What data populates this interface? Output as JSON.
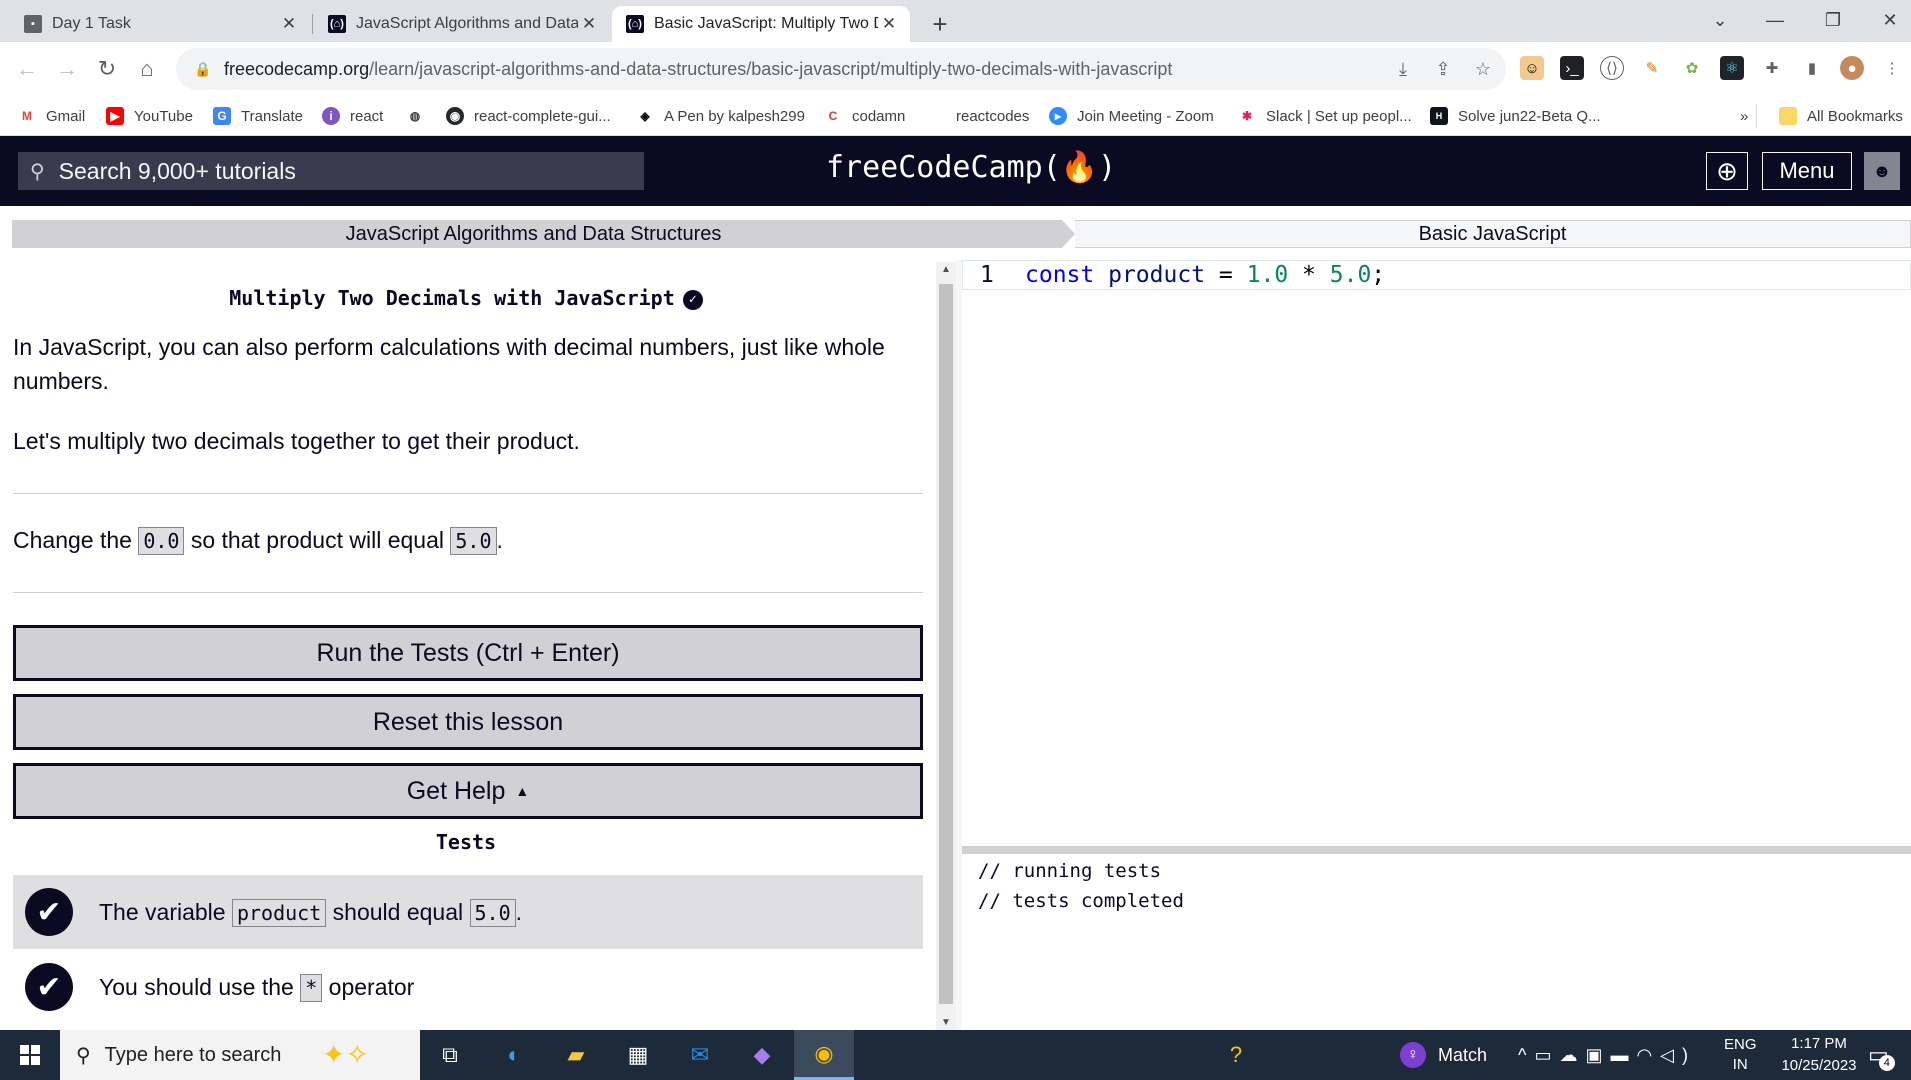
{
  "browser": {
    "tabs": [
      {
        "title": "Day 1 Task",
        "active": false
      },
      {
        "title": "JavaScript Algorithms and Data Structures",
        "active": false
      },
      {
        "title": "Basic JavaScript: Multiply Two Decimals with JavaScript",
        "active": true
      }
    ],
    "url_host": "freecodecamp.org",
    "url_path": "/learn/javascript-algorithms-and-data-structures/basic-javascript/multiply-two-decimals-with-javascript",
    "bookmarks": [
      {
        "label": "Gmail",
        "icon": "gmail-icon"
      },
      {
        "label": "YouTube",
        "icon": "youtube-icon"
      },
      {
        "label": "Translate",
        "icon": "translate-icon"
      },
      {
        "label": "react",
        "icon": "react-icon"
      },
      {
        "label": "",
        "icon": "globe-icon"
      },
      {
        "label": "react-complete-gui...",
        "icon": "github-icon"
      },
      {
        "label": "A Pen by kalpesh299",
        "icon": "codepen-icon"
      },
      {
        "label": "codamn",
        "icon": "codamn-icon"
      },
      {
        "label": "reactcodes",
        "icon": "blank-page-icon"
      },
      {
        "label": "Join Meeting - Zoom",
        "icon": "zoom-icon"
      },
      {
        "label": "Slack | Set up peopl...",
        "icon": "slack-icon"
      },
      {
        "label": "Solve jun22-Beta Q...",
        "icon": "hackerrank-icon"
      }
    ],
    "bookmarks_overflow": "»",
    "all_bookmarks": "All Bookmarks"
  },
  "fcc": {
    "search_placeholder": "Search 9,000+ tutorials",
    "logo": "freeCodeCamp(🔥)",
    "menu_label": "Menu",
    "breadcrumb_left": "JavaScript Algorithms and Data Structures",
    "breadcrumb_right": "Basic JavaScript"
  },
  "challenge": {
    "title": "Multiply Two Decimals with JavaScript",
    "para1": "In JavaScript, you can also perform calculations with decimal numbers, just like whole numbers.",
    "para2": "Let's multiply two decimals together to get their product.",
    "instr_prefix": "Change the ",
    "instr_code1": "0.0",
    "instr_mid": " so that product will equal ",
    "instr_code2": "5.0",
    "instr_suffix": ".",
    "run_button": "Run the Tests (Ctrl + Enter)",
    "reset_button": "Reset this lesson",
    "help_button": "Get Help",
    "tests_heading": "Tests",
    "tests": [
      {
        "prefix": "The variable ",
        "code": "product",
        "mid": " should equal ",
        "code2": "5.0",
        "suffix": ".",
        "passed": true
      },
      {
        "prefix": "You should use the ",
        "code": "*",
        "mid": " operator",
        "code2": "",
        "suffix": "",
        "passed": true
      }
    ]
  },
  "editor": {
    "line_number": "1",
    "tokens": {
      "kw": "const",
      "id": "product",
      "eq": "=",
      "n1": "1.0",
      "mul": "*",
      "n2": "5.0",
      "semi": ";"
    }
  },
  "console": [
    "// running tests",
    "// tests completed"
  ],
  "taskbar": {
    "search_placeholder": "Type here to search",
    "weather_label": "Match",
    "lang_top": "ENG",
    "lang_bottom": "IN",
    "time": "1:17 PM",
    "date": "10/25/2023",
    "notifications": "4"
  }
}
